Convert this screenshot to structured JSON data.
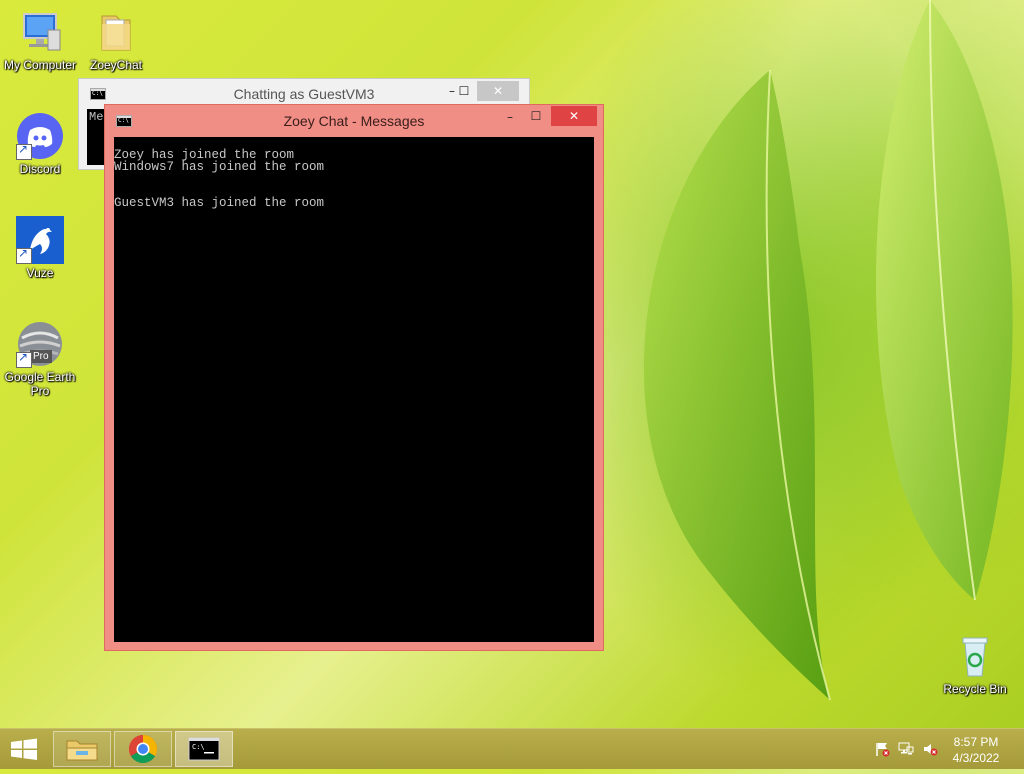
{
  "desktop": {
    "icons": [
      {
        "label": "My Computer",
        "icon": "computer-icon"
      },
      {
        "label": "ZoeyChat",
        "icon": "folder-icon"
      },
      {
        "label": "Discord",
        "icon": "discord-icon"
      },
      {
        "label": "Vuze",
        "icon": "vuze-icon"
      },
      {
        "label": "Google Earth Pro",
        "icon": "google-earth-icon",
        "badge": "Pro"
      },
      {
        "label": "Recycle Bin",
        "icon": "recycle-bin-icon"
      }
    ]
  },
  "windows": {
    "back": {
      "title": "Chatting as GuestVM3",
      "console_text": "Me"
    },
    "front": {
      "title": "Zoey Chat - Messages",
      "console_lines": [
        "Zoey has joined the room",
        "Windows7 has joined the room",
        "",
        "",
        "GuestVM3 has joined the room"
      ]
    },
    "controls": {
      "minimize": "–",
      "maximize": "☐",
      "close": "✕"
    }
  },
  "taskbar": {
    "apps": [
      "file-explorer-icon",
      "chrome-icon",
      "command-prompt-icon"
    ],
    "tray": [
      "action-center-flag-icon",
      "network-icon",
      "volume-muted-icon"
    ],
    "time": "8:57 PM",
    "date": "4/3/2022"
  },
  "colors": {
    "active_window_frame": "#f08e86",
    "close_button": "#e04343",
    "taskbar": "#b0a542"
  }
}
